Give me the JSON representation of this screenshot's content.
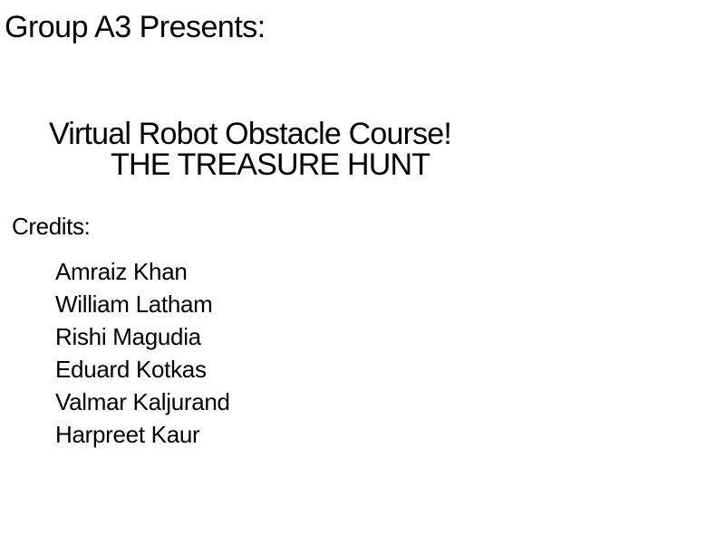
{
  "intro": {
    "presents": "Group A3 Presents:"
  },
  "game": {
    "title": "Virtual Robot Obstacle Course!",
    "subtitle": "THE TREASURE HUNT"
  },
  "credits": {
    "heading": "Credits:",
    "names": [
      "Amraiz Khan",
      "William Latham",
      "Rishi Magudia",
      "Eduard Kotkas",
      "Valmar Kaljurand",
      "Harpreet Kaur"
    ]
  },
  "colors": {
    "background": "#ffffff",
    "text": "#000000"
  }
}
